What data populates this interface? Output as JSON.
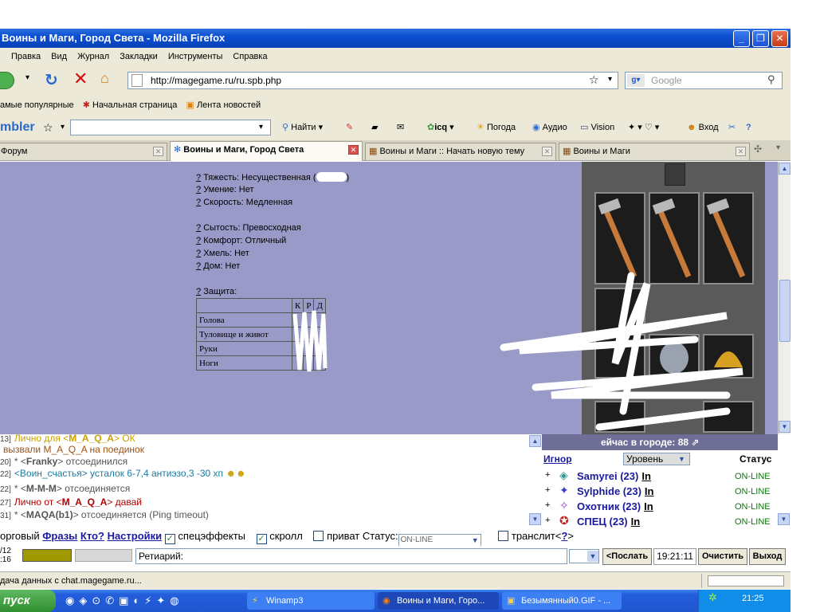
{
  "window": {
    "title": "Воины и Маги, Город Света - Mozilla Firefox"
  },
  "menu": [
    "Правка",
    "Вид",
    "Журнал",
    "Закладки",
    "Инструменты",
    "Справка"
  ],
  "nav": {
    "url": "http://magegame.ru/ru.spb.php",
    "search_placeholder": "Google"
  },
  "bookmarks": [
    "амые популярные",
    "Начальная страница",
    "Лента новостей"
  ],
  "rambler": {
    "logo": "mbler",
    "find": "Найти",
    "weather": "Погода",
    "audio": "Аудио",
    "vision": "Vision",
    "login": "Вход",
    "icq": "icq"
  },
  "tabs": [
    {
      "label": "Форум"
    },
    {
      "label": "Воины и Маги, Город Света"
    },
    {
      "label": "Воины и Маги :: Начать новую тему"
    },
    {
      "label": "Воины и Маги"
    }
  ],
  "item_stats": {
    "q": "?",
    "weight": "Тяжесть: Несущественная (",
    "weight_end": ")",
    "skill": "Умение: Нет",
    "speed": "Скорость: Медленная",
    "satiety": "Сытость: Превосходная",
    "comfort": "Комфорт: Отличный",
    "hops": "Хмель: Нет",
    "home": "Дом: Нет",
    "protection": "Защита:",
    "table_headers": [
      "К",
      "Р",
      "Д"
    ],
    "rows": [
      "Голова",
      "Туловище и живот",
      "Руки",
      "Ноги"
    ]
  },
  "chat": [
    {
      "ts": "13]",
      "pre": "Лично для <",
      "nick": "M_A_Q_A",
      "post": "> ОК",
      "color": "#c8a000"
    },
    {
      "ts": "",
      "pre": "вызвали M_A_Q_A на поединок",
      "nick": "",
      "post": "",
      "color": "#a05010"
    },
    {
      "ts": "20]",
      "pre": "* <",
      "nick": "Franky",
      "post": "> отсоединился",
      "color": "#555555"
    },
    {
      "ts": "22]",
      "pre": "<Воин_счастья> ",
      "nick": "",
      "post": "усталок 6-7,4 антиэзо,3 -30 хп",
      "color": "#1a7aa0"
    },
    {
      "ts": "22]",
      "pre": "* <",
      "nick": "M-M-M",
      "post": "> отсоединяется",
      "color": "#555555"
    },
    {
      "ts": "27]",
      "pre": "Лично от <",
      "nick": "M_A_Q_A",
      "post": "> давай",
      "color": "#b00000"
    },
    {
      "ts": "31]",
      "pre": "* <",
      "nick": "MAQA(b1)",
      "post": "> отсоединяется (Ping timeout)",
      "color": "#555555"
    }
  ],
  "online": {
    "header": "ейчас в городе: 88",
    "ignore": "Игнор",
    "level": "Уровень",
    "status": "Статус",
    "plus": "+",
    "users": [
      {
        "name": "Samyrei (23)",
        "in": "In",
        "status": "ON-LINE"
      },
      {
        "name": "Sylphide (23)",
        "in": "In",
        "status": "ON-LINE"
      },
      {
        "name": "Охотник (23)",
        "in": "In",
        "status": "ON-LINE"
      },
      {
        "name": "СПЕЦ (23)",
        "in": "In",
        "status": "ON-LINE"
      }
    ]
  },
  "controls": {
    "trade": "орговый",
    "phrases": "Фразы",
    "who": "Кто?",
    "settings": "Настройки",
    "effects": "спецэффекты",
    "scroll": "скролл",
    "private": "приват",
    "status_label": "Статус:",
    "status_value": "ON-LINE",
    "translit": "транслит<",
    "translit_q": "?",
    "translit_end": ">"
  },
  "input": {
    "date1": "/12",
    "date2": ":16",
    "message": "Ретиарий:",
    "send": "<Послать",
    "time": "19:21:11",
    "clear": "Очистить",
    "exit": "Выход"
  },
  "statusbar": {
    "text": "дача данных с chat.magegame.ru..."
  },
  "taskbar": {
    "start": "пуск",
    "tasks": [
      "Winamp3",
      "Воины и Маги, Горо...",
      "Безымянный0.GIF - ..."
    ],
    "clock": "21:25"
  }
}
